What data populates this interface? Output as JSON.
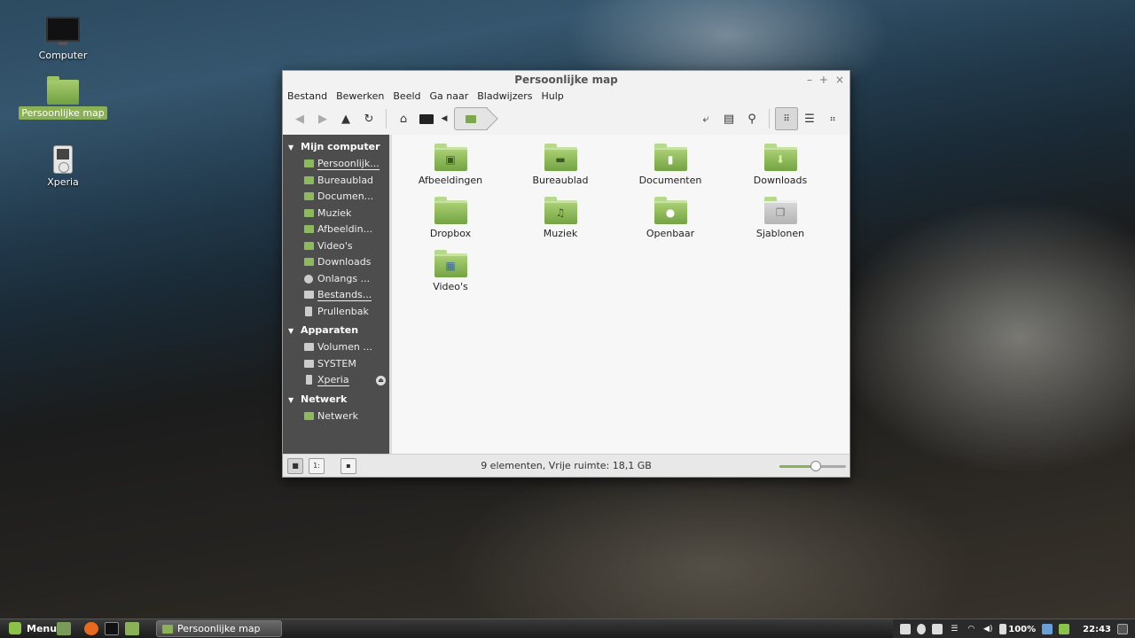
{
  "desktop": {
    "icons": [
      {
        "label": "Computer"
      },
      {
        "label": "Persoonlijke map"
      },
      {
        "label": "Xperia"
      }
    ]
  },
  "window": {
    "title": "Persoonlijke map",
    "controls": {
      "minimize": "–",
      "maximize": "+",
      "close": "×"
    },
    "menu": [
      "Bestand",
      "Bewerken",
      "Beeld",
      "Ga naar",
      "Bladwijzers",
      "Hulp"
    ],
    "sidebar": {
      "sections": [
        {
          "title": "Mijn computer",
          "items": [
            "Persoonlijke map",
            "Bureaublad",
            "Documenten",
            "Muziek",
            "Afbeeldingen",
            "Video's",
            "Downloads",
            "Onlangs gebruikt",
            "Bestandssysteem",
            "Prullenbak"
          ]
        },
        {
          "title": "Apparaten",
          "items": [
            "Volumen ...",
            "SYSTEM",
            "Xperia"
          ]
        },
        {
          "title": "Netwerk",
          "items": [
            "Netwerk"
          ]
        }
      ],
      "display_items": {
        "computer": [
          "Persoonlijk...",
          "Bureaublad",
          "Documen...",
          "Muziek",
          "Afbeeldin...",
          "Video's",
          "Downloads",
          "Onlangs ...",
          "Bestands...",
          "Prullenbak"
        ],
        "devices": [
          "Volumen ...",
          "SYSTEM",
          "Xperia"
        ],
        "network": [
          "Netwerk"
        ]
      },
      "display_headers": [
        "Mijn computer",
        "Apparaten",
        "Netwerk"
      ]
    },
    "files": [
      {
        "name": "Afbeeldingen",
        "emblem": "image"
      },
      {
        "name": "Bureaublad",
        "emblem": "desktop"
      },
      {
        "name": "Documenten",
        "emblem": "document"
      },
      {
        "name": "Downloads",
        "emblem": "download"
      },
      {
        "name": "Dropbox",
        "emblem": "none"
      },
      {
        "name": "Muziek",
        "emblem": "music"
      },
      {
        "name": "Openbaar",
        "emblem": "person"
      },
      {
        "name": "Sjablonen",
        "emblem": "template"
      },
      {
        "name": "Video's",
        "emblem": "film"
      }
    ],
    "status": "9 elementen, Vrije ruimte: 18,1 GB",
    "zoom_level": 0.55
  },
  "panel": {
    "menu_label": "Menu",
    "task_label": "Persoonlijke map",
    "battery": "100%",
    "clock": "22:43"
  }
}
